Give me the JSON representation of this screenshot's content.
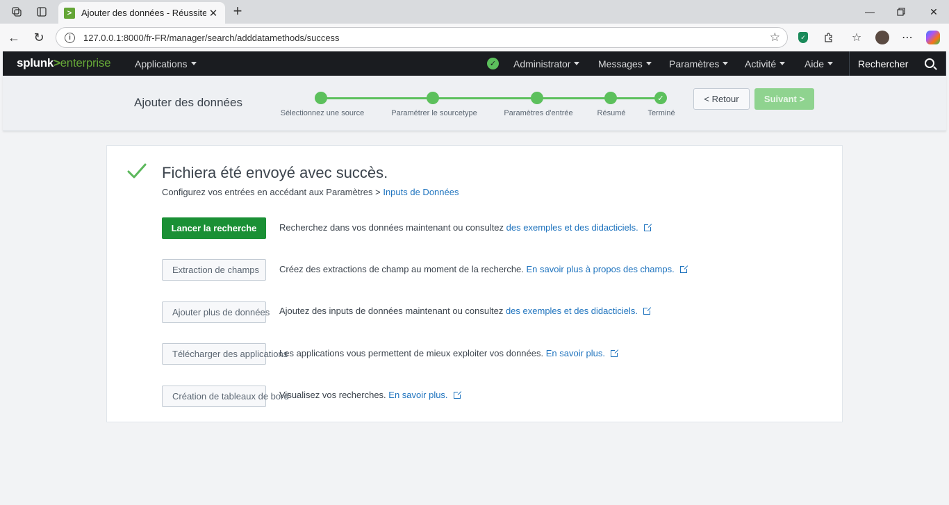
{
  "browser": {
    "tab_title": "Ajouter des données - Réussite | S",
    "url": "127.0.0.1:8000/fr-FR/manager/search/adddatamethods/success"
  },
  "topnav": {
    "logo_splunk": "splunk",
    "logo_gt": ">",
    "logo_enterprise": "enterprise",
    "applications": "Applications",
    "administrator": "Administrator",
    "messages": "Messages",
    "parametres": "Paramètres",
    "activite": "Activité",
    "aide": "Aide",
    "search": "Rechercher"
  },
  "wizard": {
    "title": "Ajouter des données",
    "steps": [
      {
        "label": "Sélectionnez une source"
      },
      {
        "label": "Paramétrer le sourcetype"
      },
      {
        "label": "Paramètres d'entrée"
      },
      {
        "label": "Résumé"
      },
      {
        "label": "Terminé"
      }
    ],
    "back": "< Retour",
    "next": "Suivant >"
  },
  "success": {
    "title": "Fichiera été envoyé avec succès.",
    "sub_text": "Configurez vos entrées en accédant aux Paramètres > ",
    "sub_link": "Inputs de Données"
  },
  "actions": [
    {
      "button": "Lancer la recherche",
      "desc": "Recherchez dans vos données maintenant ou consultez ",
      "link": "des exemples et des didacticiels."
    },
    {
      "button": "Extraction de champs",
      "desc": "Créez des extractions de champ au moment de la recherche. ",
      "link": "En savoir plus à propos des champs."
    },
    {
      "button": "Ajouter plus de données",
      "desc": "Ajoutez des inputs de données maintenant ou consultez ",
      "link": "des exemples et des didacticiels."
    },
    {
      "button": "Télécharger des applications",
      "desc": "Les applications vous permettent de mieux exploiter vos données. ",
      "link": "En savoir plus."
    },
    {
      "button": "Création de tableaux de bord",
      "desc": "Visualisez vos recherches. ",
      "link": "En savoir plus."
    }
  ],
  "colors": {
    "splunk_green": "#65a637",
    "success_green": "#5cc05c",
    "primary_button": "#1a9035",
    "link": "#1e73be"
  }
}
